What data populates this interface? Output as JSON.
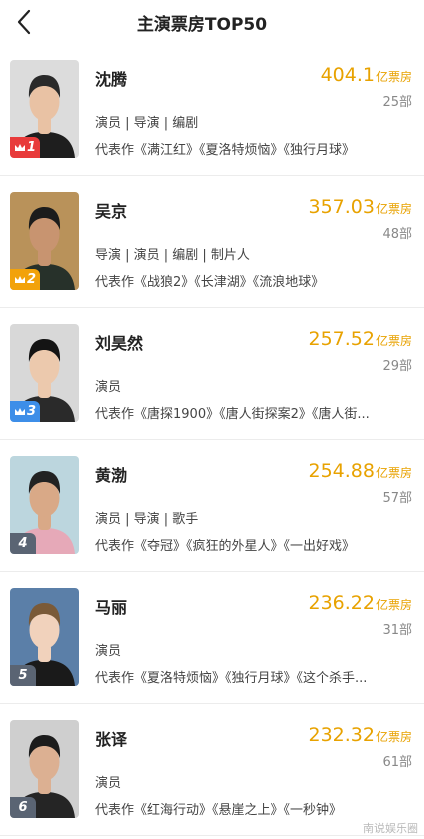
{
  "header": {
    "title": "主演票房TOP50"
  },
  "actors": [
    {
      "rank": "1",
      "name": "沈腾",
      "box_office": "404.1",
      "unit": "亿票房",
      "count": "25部",
      "roles": "演员 | 导演 | 编剧",
      "works": "代表作《满江红》《夏洛特烦恼》《独行月球》",
      "badge_color": "#e83b3b",
      "crown": true,
      "photo": {
        "bg": "#dcdcdc",
        "hair": "#2a2a2a",
        "skin": "#e9c2a4",
        "shirt": "#1e1e1e"
      }
    },
    {
      "rank": "2",
      "name": "吴京",
      "box_office": "357.03",
      "unit": "亿票房",
      "count": "48部",
      "roles": "导演 | 演员 | 编剧 | 制片人",
      "works": "代表作《战狼2》《长津湖》《流浪地球》",
      "badge_color": "#f2a20a",
      "crown": true,
      "photo": {
        "bg": "#b9925a",
        "hair": "#1c1c1c",
        "skin": "#c89470",
        "shirt": "#27312a"
      }
    },
    {
      "rank": "3",
      "name": "刘昊然",
      "box_office": "257.52",
      "unit": "亿票房",
      "count": "29部",
      "roles": "演员",
      "works": "代表作《唐探1900》《唐人街探案2》《唐人街...",
      "badge_color": "#3d8ee8",
      "crown": true,
      "photo": {
        "bg": "#d8d8d8",
        "hair": "#141414",
        "skin": "#ecc9ad",
        "shirt": "#2a2a2a"
      }
    },
    {
      "rank": "4",
      "name": "黄渤",
      "box_office": "254.88",
      "unit": "亿票房",
      "count": "57部",
      "roles": "演员 | 导演 | 歌手",
      "works": "代表作《夺冠》《疯狂的外星人》《一出好戏》",
      "badge_color": "#5a6473",
      "crown": false,
      "photo": {
        "bg": "#bcd6de",
        "hair": "#222222",
        "skin": "#d9a987",
        "shirt": "#e6a9b8"
      }
    },
    {
      "rank": "5",
      "name": "马丽",
      "box_office": "236.22",
      "unit": "亿票房",
      "count": "31部",
      "roles": "演员",
      "works": "代表作《夏洛特烦恼》《独行月球》《这个杀手...",
      "badge_color": "#5a6473",
      "crown": false,
      "photo": {
        "bg": "#5b7fa8",
        "hair": "#7a5a38",
        "skin": "#f1d2bc",
        "shirt": "#1a1a1a"
      }
    },
    {
      "rank": "6",
      "name": "张译",
      "box_office": "232.32",
      "unit": "亿票房",
      "count": "61部",
      "roles": "演员",
      "works": "代表作《红海行动》《悬崖之上》《一秒钟》",
      "badge_color": "#5a6473",
      "crown": false,
      "photo": {
        "bg": "#cfcfcf",
        "hair": "#1c1c1c",
        "skin": "#dcb092",
        "shirt": "#252525"
      }
    }
  ],
  "watermark": "南说娱乐圈"
}
